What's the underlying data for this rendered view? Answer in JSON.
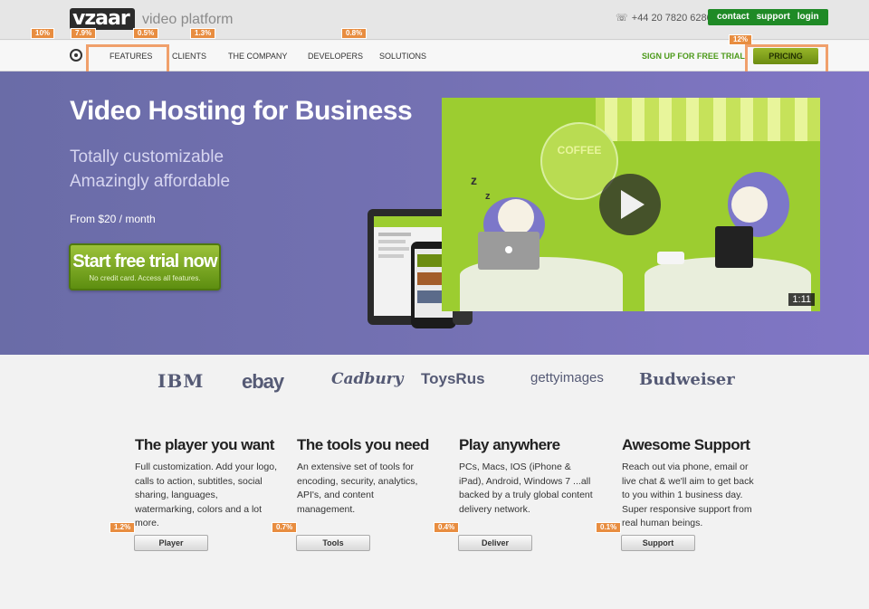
{
  "header": {
    "logo_text": "vzaar",
    "logo_tagline": "video platform",
    "phone": "+44 20 7820 6280",
    "account_links": [
      "contact",
      "support",
      "login"
    ]
  },
  "nav": {
    "items": [
      "FEATURES",
      "CLIENTS",
      "THE COMPANY",
      "DEVELOPERS",
      "SOLUTIONS"
    ],
    "signup": "SIGN UP FOR FREE TRIAL",
    "pricing": "PRICING"
  },
  "heatmap": {
    "logo_pct": "10%",
    "nav_icon_pct": "7.9%",
    "features_pct": "0.5%",
    "clients_pct": "1.3%",
    "developers_pct": "0.8%",
    "pricing_pct": "12%",
    "player_pct": "1.2%",
    "tools_pct": "0.7%",
    "deliver_pct": "0.4%",
    "support_pct": "0.1%"
  },
  "hero": {
    "title": "Video Hosting for Business",
    "subtitle_1": "Totally customizable",
    "subtitle_2": "Amazingly affordable",
    "price": "From $20 / month",
    "cta_main": "Start free trial now",
    "cta_sub": "No credit card. Access all features.",
    "video_duration": "1:11",
    "video_sign": "COFFEE"
  },
  "clients": [
    "IBM",
    "ebay",
    "Cadbury",
    "ToysRus",
    "gettyimages",
    "Budweiser"
  ],
  "features": [
    {
      "title": "The player you want",
      "body": "Full customization. Add your logo, calls to action, subtitles, social sharing, languages, watermarking, colors and a lot more.",
      "button": "Player"
    },
    {
      "title": "The tools you need",
      "body": "An extensive set of tools for encoding, security, analytics, API's, and content management.",
      "button": "Tools"
    },
    {
      "title": "Play anywhere",
      "body": "PCs, Macs, IOS (iPhone & iPad), Android, Windows 7 ...all backed by a truly global content delivery network.",
      "button": "Deliver"
    },
    {
      "title": "Awesome Support",
      "body": "Reach out via phone, email or live chat & we'll aim to get back to you within 1 business day. Super responsive support from real human beings.",
      "button": "Support"
    }
  ],
  "colors": {
    "accent_green": "#6c8c12",
    "hero_purple": "#7471b3",
    "heat_orange": "#e88d40"
  }
}
